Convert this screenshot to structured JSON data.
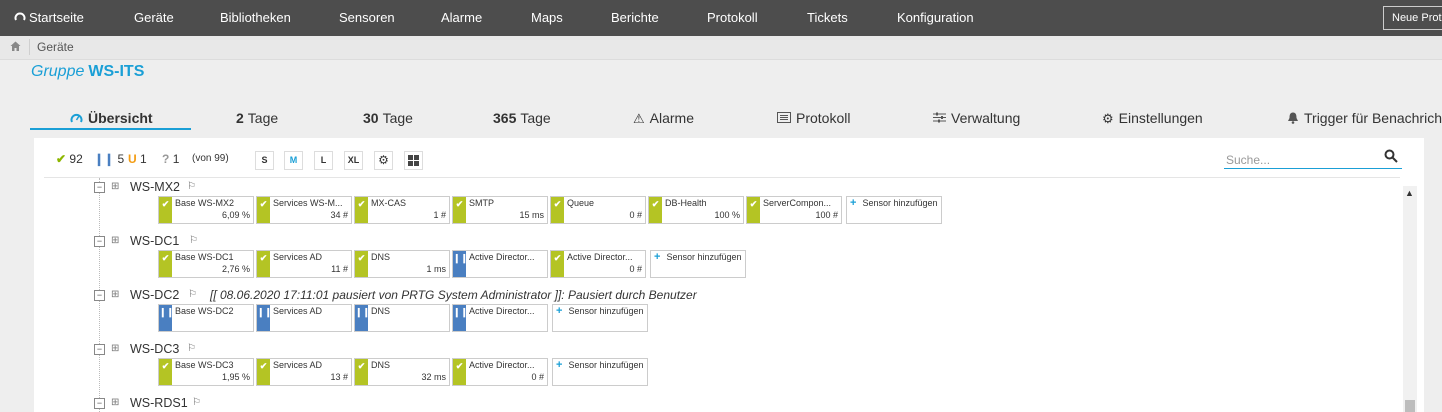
{
  "nav": {
    "items": [
      "Startseite",
      "Geräte",
      "Bibliotheken",
      "Sensoren",
      "Alarme",
      "Maps",
      "Berichte",
      "Protokoll",
      "Tickets",
      "Konfiguration"
    ],
    "new_button": "Neue Proto"
  },
  "breadcrumb": {
    "current": "Geräte"
  },
  "page": {
    "title_prefix": "Gruppe",
    "title_name": "WS-ITS"
  },
  "tabs": [
    {
      "label": "Übersicht"
    },
    {
      "num": "2",
      "label": "Tage"
    },
    {
      "num": "30",
      "label": "Tage"
    },
    {
      "num": "365",
      "label": "Tage"
    },
    {
      "label": "Alarme"
    },
    {
      "label": "Protokoll"
    },
    {
      "label": "Verwaltung"
    },
    {
      "label": "Einstellungen"
    },
    {
      "label": "Trigger für Benachrich"
    }
  ],
  "counts": {
    "up": "92",
    "paused": "5",
    "unusual": "1",
    "unknown": "1",
    "total": "(von 99)"
  },
  "sizes": [
    "S",
    "M",
    "L",
    "XL"
  ],
  "active_size": "M",
  "search": {
    "placeholder": "Suche..."
  },
  "add_sensor_label": "Sensor hinzufügen",
  "devices": [
    {
      "name": "WS-MX2",
      "note": "",
      "sensors": [
        {
          "name": "Base WS-MX2",
          "value": "6,09 %",
          "status": "up"
        },
        {
          "name": "Services WS-M...",
          "value": "34 #",
          "status": "up"
        },
        {
          "name": "MX-CAS",
          "value": "1 #",
          "status": "up"
        },
        {
          "name": "SMTP",
          "value": "15 ms",
          "status": "up"
        },
        {
          "name": "Queue",
          "value": "0 #",
          "status": "up"
        },
        {
          "name": "DB-Health",
          "value": "100 %",
          "status": "up"
        },
        {
          "name": "ServerCompon...",
          "value": "100 #",
          "status": "up"
        }
      ]
    },
    {
      "name": "WS-DC1",
      "note": "",
      "sensors": [
        {
          "name": "Base WS-DC1",
          "value": "2,76 %",
          "status": "up"
        },
        {
          "name": "Services AD",
          "value": "11 #",
          "status": "up"
        },
        {
          "name": "DNS",
          "value": "1 ms",
          "status": "up"
        },
        {
          "name": "Active Director...",
          "value": "",
          "status": "paused"
        },
        {
          "name": "Active Director...",
          "value": "0 #",
          "status": "up"
        }
      ]
    },
    {
      "name": "WS-DC2",
      "note": "[[ 08.06.2020 17:11:01 pausiert von PRTG System Administrator ]]: Pausiert durch Benutzer",
      "sensors": [
        {
          "name": "Base WS-DC2",
          "value": "",
          "status": "paused"
        },
        {
          "name": "Services AD",
          "value": "",
          "status": "paused"
        },
        {
          "name": "DNS",
          "value": "",
          "status": "paused"
        },
        {
          "name": "Active Director...",
          "value": "",
          "status": "paused"
        }
      ]
    },
    {
      "name": "WS-DC3",
      "note": "",
      "sensors": [
        {
          "name": "Base WS-DC3",
          "value": "1,95 %",
          "status": "up"
        },
        {
          "name": "Services AD",
          "value": "13 #",
          "status": "up"
        },
        {
          "name": "DNS",
          "value": "32 ms",
          "status": "up"
        },
        {
          "name": "Active Director...",
          "value": "0 #",
          "status": "up"
        }
      ]
    },
    {
      "name": "WS-RDS1",
      "note": "",
      "sensors": []
    }
  ]
}
